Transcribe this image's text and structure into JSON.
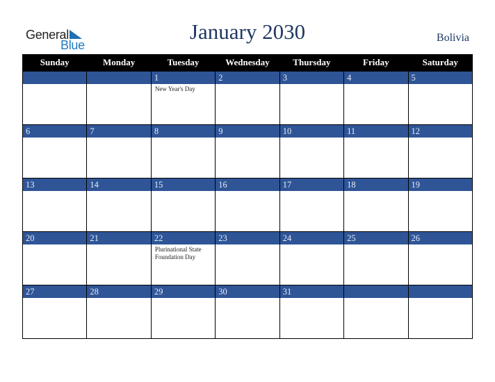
{
  "logo": {
    "word1": "General",
    "word2": "Blue",
    "icon": "triangle-flag-icon"
  },
  "header": {
    "title": "January 2030",
    "country": "Bolivia"
  },
  "colors": {
    "title": "#1f3864",
    "band": "#2f5597",
    "header_bg": "#000000",
    "logo_blue": "#1f7bc1"
  },
  "weekdays": [
    "Sunday",
    "Monday",
    "Tuesday",
    "Wednesday",
    "Thursday",
    "Friday",
    "Saturday"
  ],
  "weeks": [
    {
      "days": [
        "",
        "",
        "1",
        "2",
        "3",
        "4",
        "5"
      ],
      "holidays": [
        "",
        "",
        "New Year's Day",
        "",
        "",
        "",
        ""
      ]
    },
    {
      "days": [
        "6",
        "7",
        "8",
        "9",
        "10",
        "11",
        "12"
      ],
      "holidays": [
        "",
        "",
        "",
        "",
        "",
        "",
        ""
      ]
    },
    {
      "days": [
        "13",
        "14",
        "15",
        "16",
        "17",
        "18",
        "19"
      ],
      "holidays": [
        "",
        "",
        "",
        "",
        "",
        "",
        ""
      ]
    },
    {
      "days": [
        "20",
        "21",
        "22",
        "23",
        "24",
        "25",
        "26"
      ],
      "holidays": [
        "",
        "",
        "Plurinational State Foundation Day",
        "",
        "",
        "",
        ""
      ]
    },
    {
      "days": [
        "27",
        "28",
        "29",
        "30",
        "31",
        "",
        ""
      ],
      "holidays": [
        "",
        "",
        "",
        "",
        "",
        "",
        ""
      ]
    }
  ]
}
